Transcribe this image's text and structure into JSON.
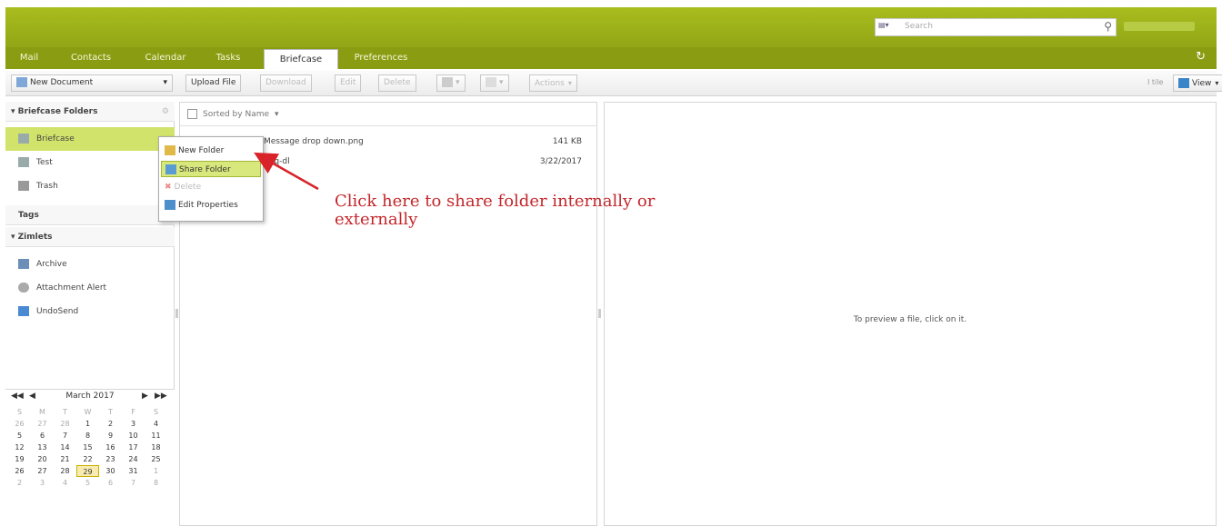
{
  "header": {
    "search_placeholder": "Search",
    "search_scope_icon": "briefcase-icon"
  },
  "tabs": [
    {
      "label": "Mail"
    },
    {
      "label": "Contacts"
    },
    {
      "label": "Calendar"
    },
    {
      "label": "Tasks"
    },
    {
      "label": "Briefcase",
      "active": true
    },
    {
      "label": "Preferences"
    }
  ],
  "toolbar": {
    "new_document": "New Document",
    "upload_file": "Upload File",
    "download": "Download",
    "edit": "Edit",
    "delete": "Delete",
    "actions": "Actions",
    "view": "View",
    "tile": "I tile"
  },
  "sidebar": {
    "briefcase_header": "Briefcase Folders",
    "folders": [
      {
        "label": "Briefcase"
      },
      {
        "label": "Test"
      },
      {
        "label": "Trash"
      }
    ],
    "tags_header": "Tags",
    "zimlets_header": "Zimlets",
    "zimlets": [
      {
        "label": "Archive"
      },
      {
        "label": "Attachment Alert"
      },
      {
        "label": "UndoSend"
      }
    ]
  },
  "calendar": {
    "month": "March 2017",
    "weekdays": [
      "S",
      "M",
      "T",
      "W",
      "T",
      "F",
      "S"
    ],
    "weeks": [
      [
        "26",
        "27",
        "28",
        "1",
        "2",
        "3",
        "4"
      ],
      [
        "5",
        "6",
        "7",
        "8",
        "9",
        "10",
        "11"
      ],
      [
        "12",
        "13",
        "14",
        "15",
        "16",
        "17",
        "18"
      ],
      [
        "19",
        "20",
        "21",
        "22",
        "23",
        "24",
        "25"
      ],
      [
        "26",
        "27",
        "28",
        "29",
        "30",
        "31",
        "1"
      ],
      [
        "2",
        "3",
        "4",
        "5",
        "6",
        "7",
        "8"
      ]
    ],
    "today": "29"
  },
  "list": {
    "sort_label": "Sorted by Name",
    "files": [
      {
        "name": "Message drop down.png",
        "meta": "141 KB"
      },
      {
        "name": "nhq-dl",
        "meta": "3/22/2017"
      }
    ]
  },
  "context_menu": {
    "items": [
      {
        "label": "New Folder"
      },
      {
        "label": "Share Folder"
      },
      {
        "label": "Delete"
      },
      {
        "label": "Edit Properties"
      }
    ]
  },
  "preview": {
    "message": "To preview a file, click on it."
  },
  "annotation": {
    "text": "Click here to share folder internally or externally"
  }
}
